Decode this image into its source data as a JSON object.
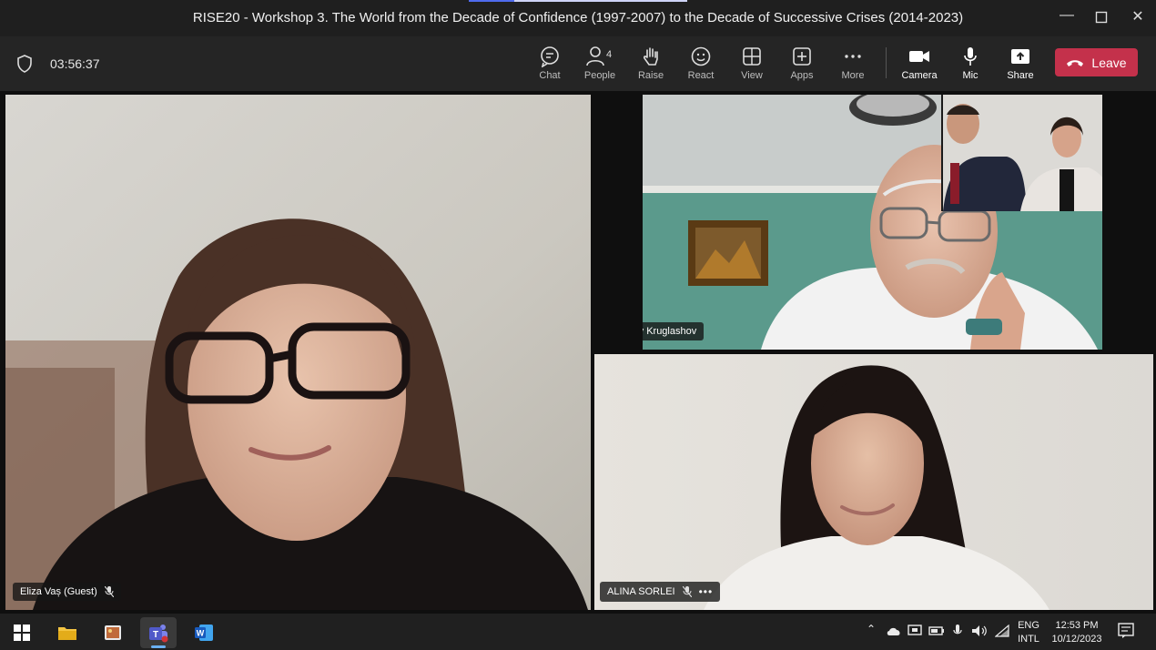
{
  "window": {
    "title": "RISE20 - Workshop 3. The World from the Decade of Confidence (1997-2007) to the Decade of Successive Crises (2014-2023)",
    "controls": [
      "minimize-icon",
      "maximize-icon",
      "close-icon"
    ]
  },
  "meeting": {
    "elapsed": "03:56:37"
  },
  "toolbar": {
    "chat": "Chat",
    "people": "People",
    "people_count": "4",
    "raise": "Raise",
    "react": "React",
    "view": "View",
    "apps": "Apps",
    "more": "More",
    "camera": "Camera",
    "mic": "Mic",
    "share": "Share",
    "leave": "Leave"
  },
  "participants": [
    {
      "name": "Eliza Vaș (Guest)",
      "muted": true
    },
    {
      "name": "Anatoliy Kruglashov",
      "muted": false
    },
    {
      "name": "ALINA SORLEI",
      "muted": true
    }
  ],
  "taskbar": {
    "apps": [
      "windows-start-icon",
      "file-explorer-icon",
      "photos-icon",
      "teams-icon",
      "word-icon"
    ],
    "lang_top": "ENG",
    "lang_bottom": "INTL",
    "time": "12:53 PM",
    "date": "10/12/2023"
  },
  "colors": {
    "leave": "#c4314b",
    "accent": "#4f6bed",
    "background": "#1f1f1f"
  }
}
